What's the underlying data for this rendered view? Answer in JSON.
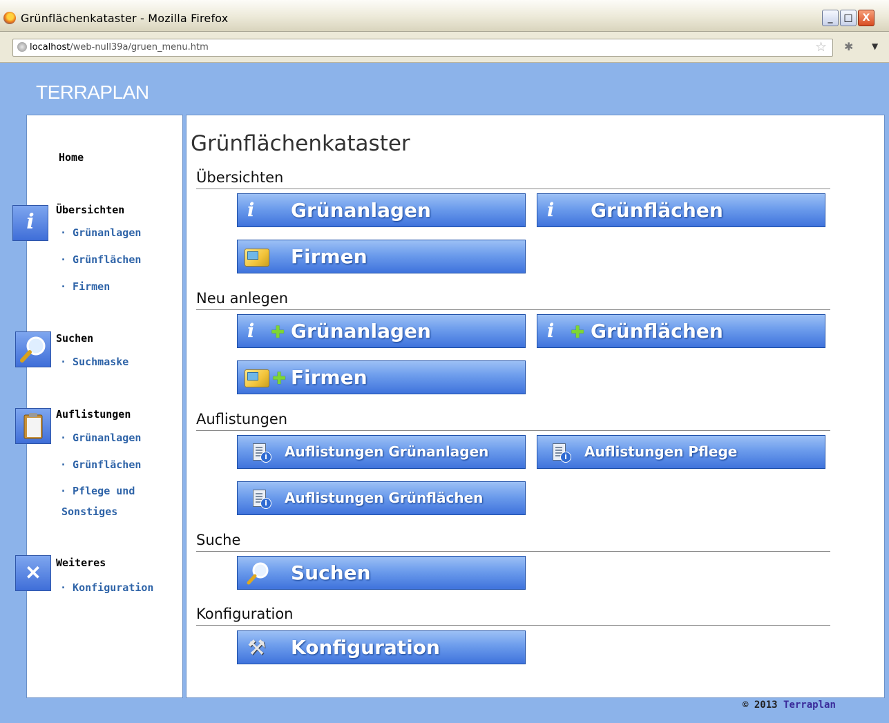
{
  "window": {
    "title": "Grünflächenkataster - Mozilla Firefox",
    "url_host": "localhost",
    "url_path": "/web-null39a/gruen_menu.htm",
    "min_label": "_",
    "max_label": "□",
    "close_label": "X"
  },
  "brand": "TERRAPLAN",
  "sidebar": {
    "home": "Home",
    "groups": [
      {
        "title": "Übersichten",
        "icon": "info-icon",
        "links": [
          "· Grünanlagen",
          "· Grünflächen",
          "· Firmen"
        ]
      },
      {
        "title": "Suchen",
        "icon": "magnifier-icon",
        "links": [
          "· Suchmaske"
        ]
      },
      {
        "title": "Auflistungen",
        "icon": "clipboard-icon",
        "links": [
          "· Grünanlagen",
          "· Grünflächen",
          "· Pflege und",
          "Sonstiges"
        ]
      },
      {
        "title": "Weiteres",
        "icon": "tools-icon",
        "links": [
          "· Konfiguration"
        ]
      }
    ]
  },
  "main": {
    "title": "Grünflächenkataster",
    "sections": [
      {
        "title": "Übersichten",
        "buttons": [
          "Grünanlagen",
          "Grünflächen",
          "Firmen"
        ]
      },
      {
        "title": "Neu anlegen",
        "buttons": [
          "Grünanlagen",
          "Grünflächen",
          "Firmen"
        ]
      },
      {
        "title": "Auflistungen",
        "buttons": [
          "Auflistungen Grünanlagen",
          "Auflistungen Pflege",
          "Auflistungen Grünflächen"
        ]
      },
      {
        "title": "Suche",
        "buttons": [
          "Suchen"
        ]
      },
      {
        "title": "Konfiguration",
        "buttons": [
          "Konfiguration"
        ]
      }
    ]
  },
  "footer": {
    "copyright_prefix": "© 2013",
    "copyright_link": "Terraplan"
  },
  "colors": {
    "page_bg": "#8cb3ea",
    "button_top": "#9cc0f5",
    "button_bottom": "#3f73dc",
    "link": "#2f64a8"
  }
}
